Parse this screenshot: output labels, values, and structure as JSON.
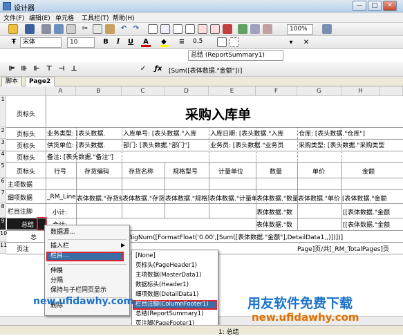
{
  "window": {
    "title": "设计器",
    "min": "—",
    "max": "□",
    "close": "✕"
  },
  "menu": [
    "文件(F)",
    "编辑(E)",
    "单元格",
    "工具栏(T)",
    "帮助(H)"
  ],
  "toolbar2": {
    "font": "宋体",
    "size": "10",
    "line": "0.5",
    "band": "总结 (ReportSummary1)"
  },
  "toolbar1": {
    "zoom": "100%"
  },
  "formula": "[Sum([表体数据.\"金额\"])]",
  "tabs": [
    "脚本",
    "Page2"
  ],
  "columns": [
    "A",
    "B",
    "C",
    "D",
    "E",
    "F",
    "G",
    "H"
  ],
  "rows": [
    {
      "n": "1",
      "label": "页标头"
    },
    {
      "n": "2",
      "label": "页标头"
    },
    {
      "n": "3",
      "label": "页标头"
    },
    {
      "n": "4",
      "label": "页标头"
    },
    {
      "n": "5",
      "label": "页标头"
    },
    {
      "n": "6",
      "label": "主项数据"
    },
    {
      "n": "7",
      "label": "细项数据"
    },
    {
      "n": "8",
      "label": "栏目注脚"
    },
    {
      "n": "9",
      "label": "总结"
    },
    {
      "n": "10",
      "label": "总"
    },
    {
      "n": "11",
      "label": "页注"
    }
  ],
  "sheet": {
    "title": "采购入库单",
    "r2": [
      "业务类型: [表头数据.",
      "入库单号: [表头数据.\"入库",
      "入库日期: [表头数据.\"入库",
      "仓库: [表头数据.\"仓库\"]"
    ],
    "r3": [
      "供货单位: [表头数据.",
      "部门: [表头数据.\"部门\"]",
      "业务员: [表头数据.\"业务员",
      "采购类型: [表头数据.\"采购类型"
    ],
    "r4": "备注: [表头数据.\"备注\"]",
    "r5": [
      "行号",
      "存货编码",
      "存货名称",
      "规格型号",
      "计量单位",
      "数量",
      "单价",
      "金额"
    ],
    "r7": [
      "_RM_Line]",
      "表体数据.\"存货编",
      "表体数据.\"存货名",
      "表体数据.\"规格型",
      "表体数据.\"计量单",
      "表体数据.\"数量",
      "表体数据.\"单价",
      "[表体数据.\"金额"
    ],
    "r8": [
      "小计:",
      "表体数据.\"数",
      "[[表体数据.\"金额"
    ],
    "r9": [
      "合计:",
      "表体数据.\"数",
      "[[表体数据.\"金额"
    ],
    "r10": "ToBigNum([FormatFloat('0.00',[Sum([表体数据.\"金额\"],DetailData1,,)])])]",
    "r11": "Page]页/共[_RM_TotalPages]页"
  },
  "context_menu": [
    "数据源...",
    "插入栏",
    "栏目...",
    "伸展",
    "分隔",
    "保持与子栏同页显示",
    "删除"
  ],
  "submenu": [
    "[None]",
    "页标头(PageHeader1)",
    "主项数据(MasterData1)",
    "数据标头(Header1)",
    "细项数据(DetailData1)",
    "栏目注脚(ColumnFooter1)",
    "总结(ReportSummary1)",
    "页注脚(PageFooter1)"
  ],
  "watermark": {
    "url1": "new.ufidawhy.com",
    "brand": "用友软件免费下载",
    "url2": "new.ufidawhy.com"
  },
  "status": "1: 总结",
  "colors": {
    "accent_red": "#e0202a",
    "highlight_blue": "#3a6ea5",
    "watermark_blue": "#1a72c9"
  }
}
